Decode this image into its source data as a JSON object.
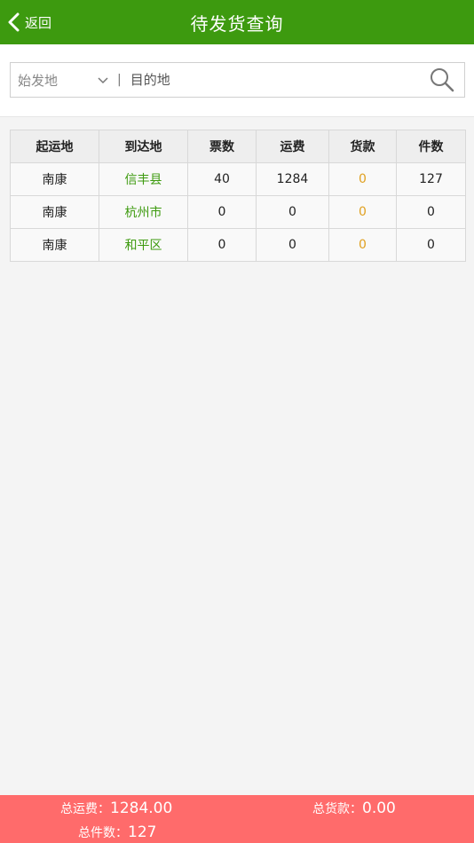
{
  "header": {
    "back_label": "返回",
    "title": "待发货查询"
  },
  "search": {
    "origin_placeholder": "始发地",
    "separator": "|",
    "destination_placeholder": "目的地",
    "destination_value": ""
  },
  "table": {
    "columns": [
      "起运地",
      "到达地",
      "票数",
      "运费",
      "货款",
      "件数"
    ],
    "rows": [
      {
        "origin": "南康",
        "destination": "信丰县",
        "tickets": "40",
        "freight": "1284",
        "goods_payment": "0",
        "pieces": "127"
      },
      {
        "origin": "南康",
        "destination": "杭州市",
        "tickets": "0",
        "freight": "0",
        "goods_payment": "0",
        "pieces": "0"
      },
      {
        "origin": "南康",
        "destination": "和平区",
        "tickets": "0",
        "freight": "0",
        "goods_payment": "0",
        "pieces": "0"
      }
    ]
  },
  "footer": {
    "total_freight_label": "总运费：",
    "total_freight_value": "1284.00",
    "total_goods_label": "总货款：",
    "total_goods_value": "0.00",
    "total_pieces_label": "总件数：",
    "total_pieces_value": "127"
  },
  "colors": {
    "header_bg": "#3d9a0f",
    "destination_text": "#3d9a0f",
    "goods_text": "#e0a020",
    "footer_bg": "#ff6b6b"
  },
  "icons": {
    "back": "chevron-left-icon",
    "dropdown": "chevron-down-icon",
    "search": "search-icon"
  }
}
